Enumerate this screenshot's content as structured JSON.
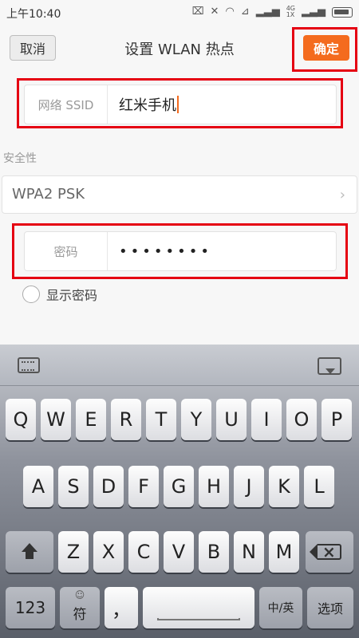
{
  "status": {
    "time": "上午10:40",
    "net_label_top": "4G",
    "net_label_bottom": "1X"
  },
  "header": {
    "cancel_label": "取消",
    "title": "设置 WLAN 热点",
    "ok_label": "确定",
    "accent": "#f46b1e"
  },
  "form": {
    "ssid_label": "网络 SSID",
    "ssid_value": "红米手机",
    "security_section": "安全性",
    "security_value": "WPA2 PSK",
    "password_label": "密码",
    "password_value": "••••••••",
    "show_password_label": "显示密码",
    "show_password_checked": false
  },
  "keyboard": {
    "row1": [
      "Q",
      "W",
      "E",
      "R",
      "T",
      "Y",
      "U",
      "I",
      "O",
      "P"
    ],
    "row2": [
      "A",
      "S",
      "D",
      "F",
      "G",
      "H",
      "J",
      "K",
      "L"
    ],
    "row3": [
      "Z",
      "X",
      "C",
      "V",
      "B",
      "N",
      "M"
    ],
    "numbers_label": "123",
    "symbols_label": "符",
    "comma_label": "，",
    "lang_label": "中/英",
    "enter_label": "选项"
  }
}
